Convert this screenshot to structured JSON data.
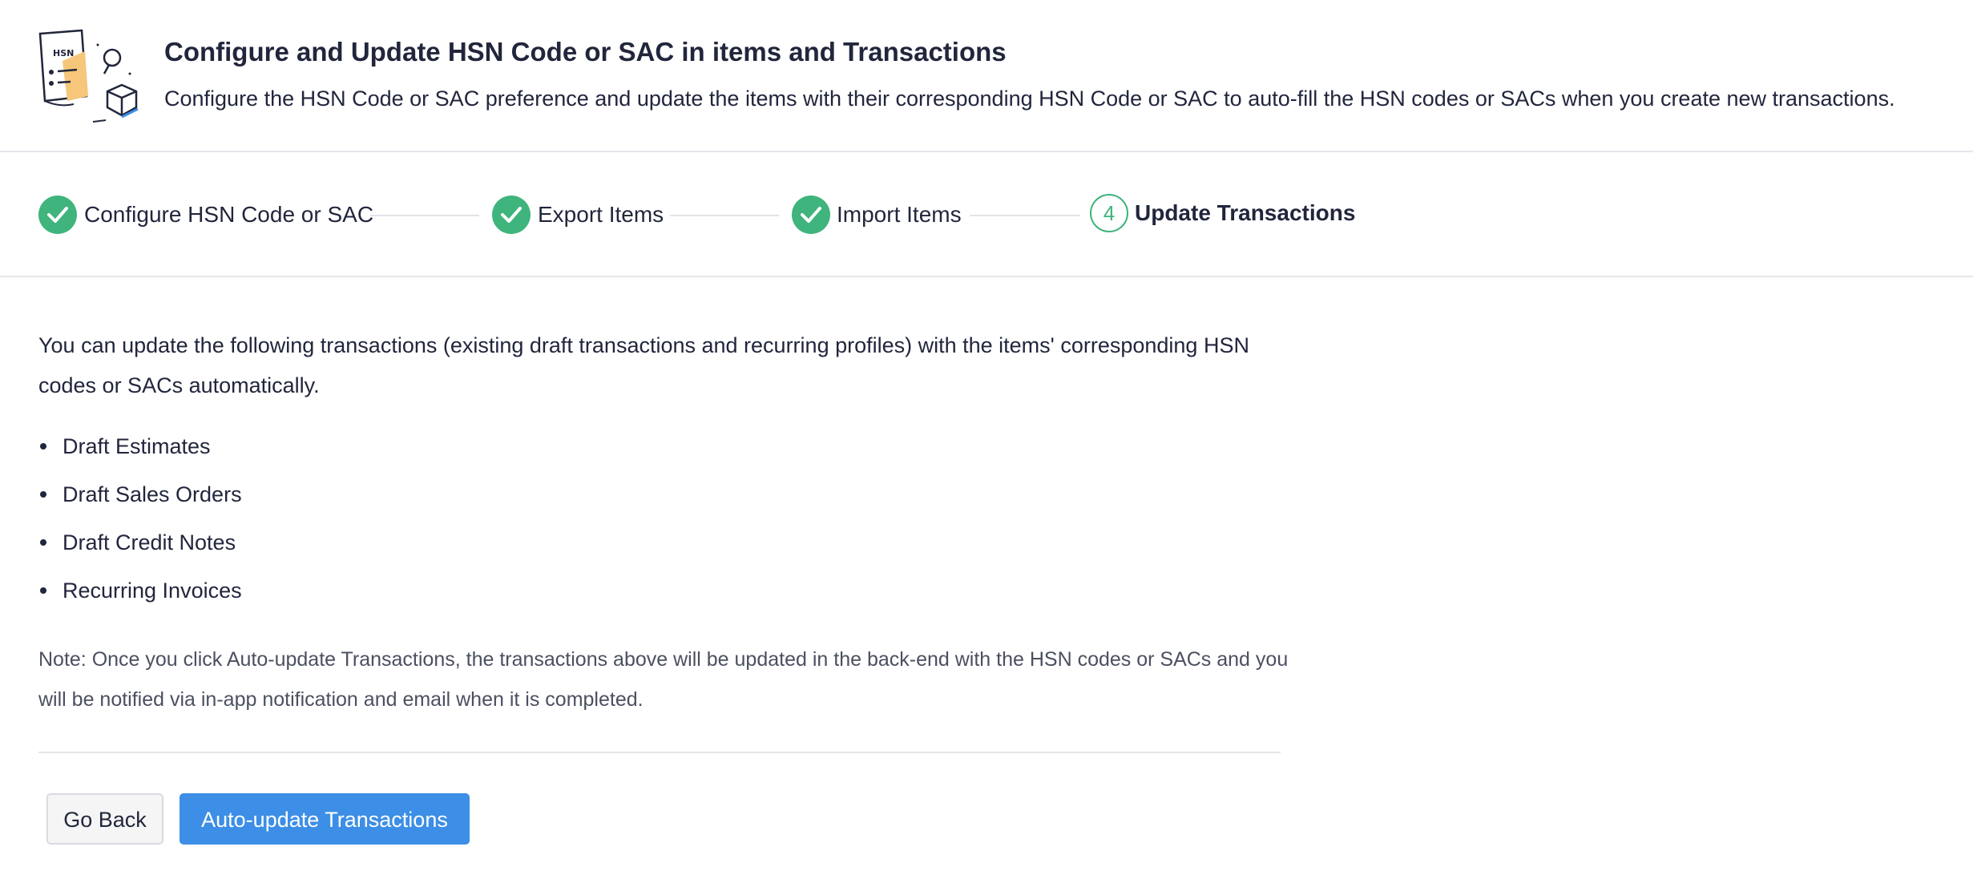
{
  "header": {
    "illustration_text": "HSN",
    "title": "Configure and Update HSN Code or SAC in items and Transactions",
    "description": "Configure the HSN Code or SAC preference and update the items with their corresponding HSN Code or SAC to auto-fill the HSN codes or SACs when you create new transactions."
  },
  "stepper": {
    "steps": [
      {
        "label": "Configure HSN Code or SAC",
        "status": "done"
      },
      {
        "label": "Export Items",
        "status": "done"
      },
      {
        "label": "Import Items",
        "status": "done"
      },
      {
        "number": "4",
        "label": "Update Transactions",
        "status": "active"
      }
    ]
  },
  "content": {
    "intro": "You can update the following transactions (existing draft transactions and recurring profiles) with the items' corresponding HSN codes or SACs automatically.",
    "transactions": [
      "Draft Estimates",
      "Draft Sales Orders",
      "Draft Credit Notes",
      "Recurring Invoices"
    ],
    "note": "Note: Once you click Auto-update Transactions, the transactions above will be updated in the back-end with the HSN codes or SACs and you will be notified via in-app notification and email when it is completed."
  },
  "actions": {
    "back_label": "Go Back",
    "auto_update_label": "Auto-update Transactions"
  },
  "colors": {
    "success_green": "#3fb47c",
    "primary_blue": "#3c8ee6",
    "text_dark": "#21263c"
  }
}
